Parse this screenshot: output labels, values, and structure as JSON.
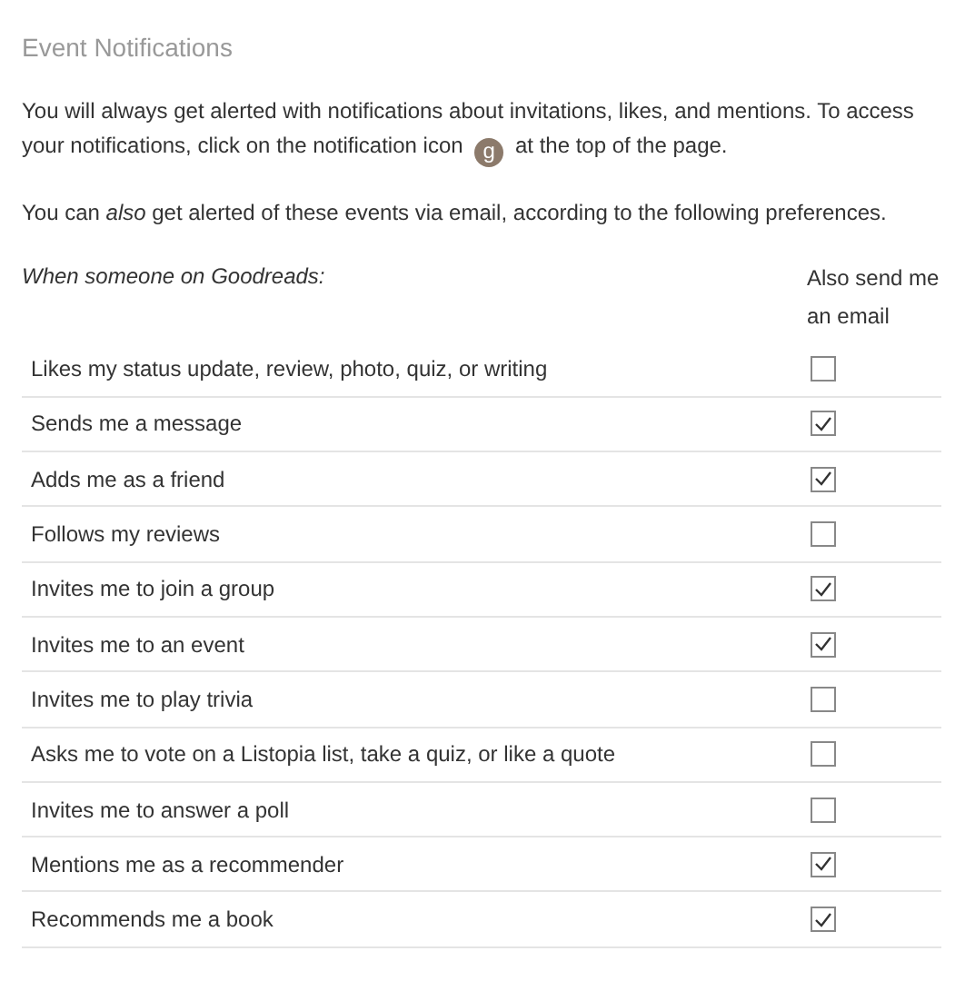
{
  "title": "Event Notifications",
  "intro": {
    "first_line": "You will always get alerted with notifications about invitations, likes, and mentions. To access",
    "before_icon": "your notifications, click on the notification icon",
    "icon_letter": "g",
    "after_icon": "at the top of the page."
  },
  "email_note": "You can *also* get alerted of these events via email, according to the following preferences.",
  "table": {
    "columns": [
      "When someone on Goodreads:",
      "Also send me an email"
    ],
    "rows": [
      {
        "label": "Likes my status update, review, photo, quiz, or writing",
        "checked": false
      },
      {
        "label": "Sends me a message",
        "checked": true
      },
      {
        "label": "Adds me as a friend",
        "checked": true
      },
      {
        "label": "Follows my reviews",
        "checked": false
      },
      {
        "label": "Invites me to join a group",
        "checked": true
      },
      {
        "label": "Invites me to an event",
        "checked": true
      },
      {
        "label": "Invites me to play trivia",
        "checked": false
      },
      {
        "label": "Asks me to vote on a Listopia list, take a quiz, or like a quote",
        "checked": false
      },
      {
        "label": "Invites me to answer a poll",
        "checked": false
      },
      {
        "label": "Mentions me as a recommender",
        "checked": true
      },
      {
        "label": "Recommends me a book",
        "checked": true
      }
    ]
  }
}
